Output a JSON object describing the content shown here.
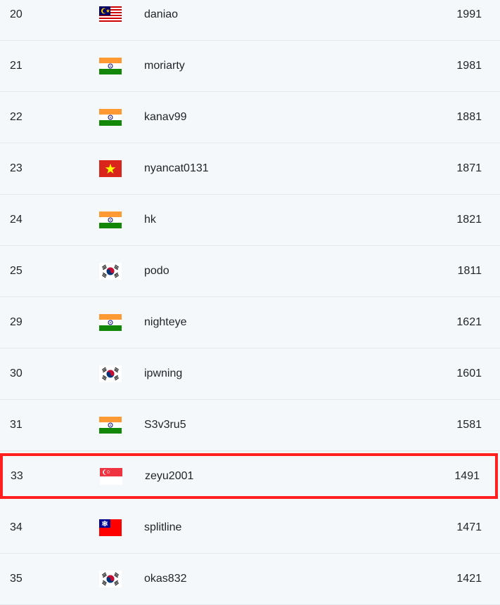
{
  "rows": [
    {
      "rank": "20",
      "flag": "malaysia-flag-icon",
      "name": "daniao",
      "score": "1991",
      "highlight": false
    },
    {
      "rank": "21",
      "flag": "india-flag-icon",
      "name": "moriarty",
      "score": "1981",
      "highlight": false
    },
    {
      "rank": "22",
      "flag": "india-flag-icon",
      "name": "kanav99",
      "score": "1881",
      "highlight": false
    },
    {
      "rank": "23",
      "flag": "vietnam-flag-icon",
      "name": "nyancat0131",
      "score": "1871",
      "highlight": false
    },
    {
      "rank": "24",
      "flag": "india-flag-icon",
      "name": "hk",
      "score": "1821",
      "highlight": false
    },
    {
      "rank": "25",
      "flag": "south-korea-flag-icon",
      "name": "podo",
      "score": "1811",
      "highlight": false
    },
    {
      "rank": "29",
      "flag": "india-flag-icon",
      "name": "nighteye",
      "score": "1621",
      "highlight": false
    },
    {
      "rank": "30",
      "flag": "south-korea-flag-icon",
      "name": "ipwning",
      "score": "1601",
      "highlight": false
    },
    {
      "rank": "31",
      "flag": "india-flag-icon",
      "name": "S3v3ru5",
      "score": "1581",
      "highlight": false
    },
    {
      "rank": "33",
      "flag": "singapore-flag-icon",
      "name": "zeyu2001",
      "score": "1491",
      "highlight": true
    },
    {
      "rank": "34",
      "flag": "taiwan-flag-icon",
      "name": "splitline",
      "score": "1471",
      "highlight": false
    },
    {
      "rank": "35",
      "flag": "south-korea-flag-icon",
      "name": "okas832",
      "score": "1421",
      "highlight": false
    }
  ],
  "colors": {
    "background": "#f5f8fb",
    "divider": "#e3e8ee",
    "highlight_border": "#ff1f1f"
  }
}
